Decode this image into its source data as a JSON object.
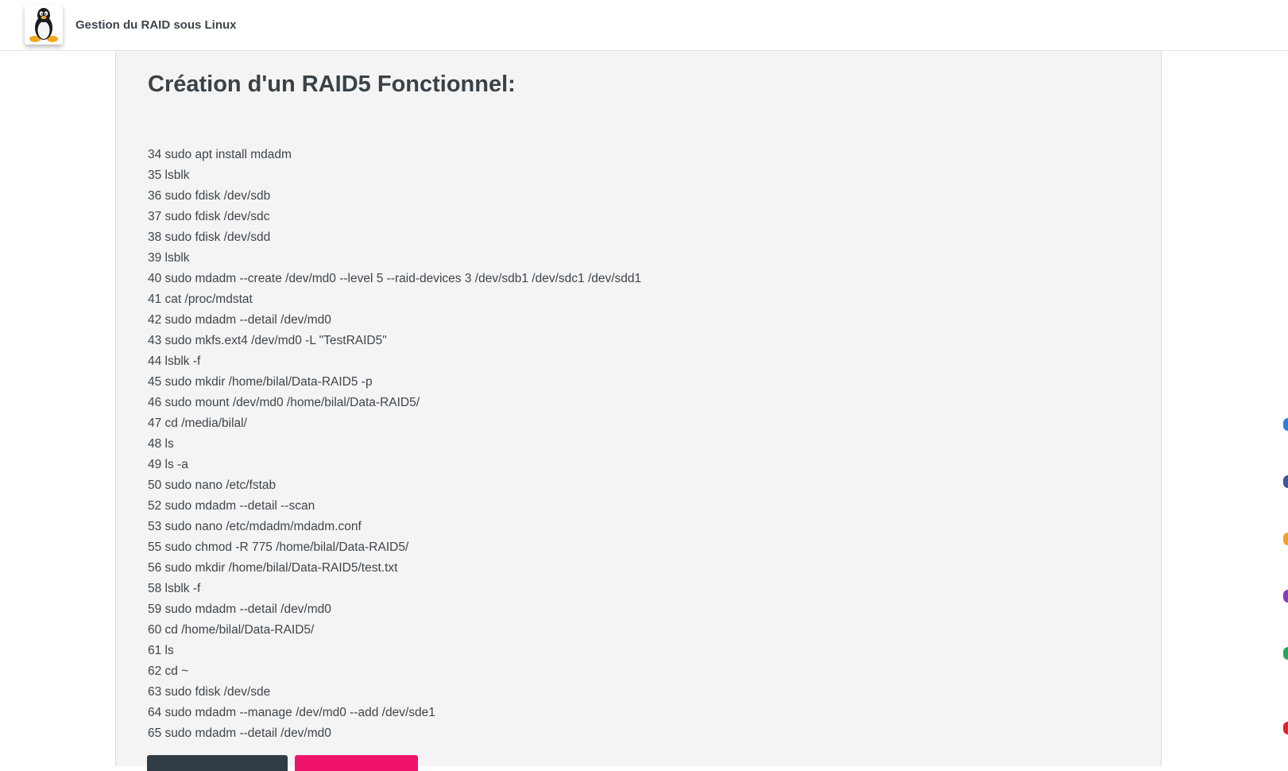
{
  "header": {
    "logo_icon": "linux-tux-icon",
    "title": "Gestion du RAID sous Linux"
  },
  "main": {
    "heading": "Création d'un RAID5 Fonctionnel:",
    "commands": [
      "34 sudo apt install mdadm",
      "35 lsblk",
      "36 sudo fdisk /dev/sdb",
      "37 sudo fdisk /dev/sdc",
      "38 sudo fdisk /dev/sdd",
      "39 lsblk",
      "40 sudo mdadm --create /dev/md0 --level 5 --raid-devices 3 /dev/sdb1 /dev/sdc1 /dev/sdd1",
      "41 cat /proc/mdstat",
      "42 sudo mdadm --detail /dev/md0",
      "43 sudo mkfs.ext4 /dev/md0 -L \"TestRAID5\"",
      "44 lsblk -f",
      "45 sudo mkdir /home/bilal/Data-RAID5 -p",
      "46 sudo mount /dev/md0 /home/bilal/Data-RAID5/",
      "47 cd /media/bilal/",
      "48 ls",
      "49 ls -a",
      "50 sudo nano /etc/fstab",
      "52 sudo mdadm --detail --scan",
      "53 sudo nano /etc/mdadm/mdadm.conf",
      "55 sudo chmod -R 775 /home/bilal/Data-RAID5/",
      "56 sudo mkdir /home/bilal/Data-RAID5/test.txt",
      "58 lsblk -f",
      "59 sudo mdadm --detail /dev/md0",
      "60 cd /home/bilal/Data-RAID5/",
      "61 ls",
      "62 cd ~",
      "63 sudo fdisk /dev/sde",
      "64 sudo mdadm --manage /dev/md0 --add /dev/sde1",
      "65 sudo mdadm --detail /dev/md0"
    ]
  },
  "colors": {
    "panel_bg": "#f4f4f4",
    "text": "#3a4147",
    "button_dark": "#2f3b45",
    "button_accent": "#f0136b"
  }
}
